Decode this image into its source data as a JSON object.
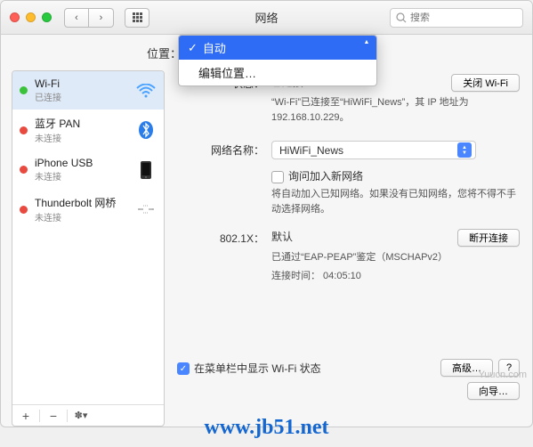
{
  "window": {
    "title": "网络"
  },
  "toolbar": {
    "back": "‹",
    "fwd": "›",
    "search_placeholder": "搜索"
  },
  "location": {
    "label": "位置：",
    "selected": "自动",
    "options": [
      "自动"
    ],
    "edit": "编辑位置…"
  },
  "services": [
    {
      "name": "Wi-Fi",
      "status": "已连接",
      "color": "g",
      "icon": "wifi"
    },
    {
      "name": "蓝牙 PAN",
      "status": "未连接",
      "color": "r",
      "icon": "bt"
    },
    {
      "name": "iPhone USB",
      "status": "未连接",
      "color": "r",
      "icon": "phone"
    },
    {
      "name": "Thunderbolt 网桥",
      "status": "未连接",
      "color": "r",
      "icon": "tb"
    }
  ],
  "detail": {
    "status_label": "状态：",
    "status_value": "已连接",
    "turn_off_btn": "关闭 Wi-Fi",
    "status_sub": "“Wi-Fi”已连接至“HiWiFi_News”，其 IP 地址为 192.168.10.229。",
    "network_name_label": "网络名称：",
    "network_name_value": "HiWiFi_News",
    "ask_join_label": "询问加入新网络",
    "ask_join_sub": "将自动加入已知网络。如果没有已知网络，您将不得不手动选择网络。",
    "dot1x_label": "802.1X：",
    "dot1x_value": "默认",
    "disconnect_btn": "断开连接",
    "dot1x_sub1": "已通过“EAP-PEAP”鉴定（MSCHAPv2）",
    "dot1x_sub2": "连接时间：  04:05:10",
    "menubar_cb_label": "在菜单栏中显示 Wi-Fi 状态",
    "advanced_btn": "高级…",
    "help_btn": "?",
    "assist_btn": "向导…"
  },
  "sidebar_footer": {
    "add": "+",
    "remove": "−",
    "gear": "✽▾"
  },
  "watermark_site": "www.jb51.net",
  "watermark_corner": "Yuucn.com"
}
